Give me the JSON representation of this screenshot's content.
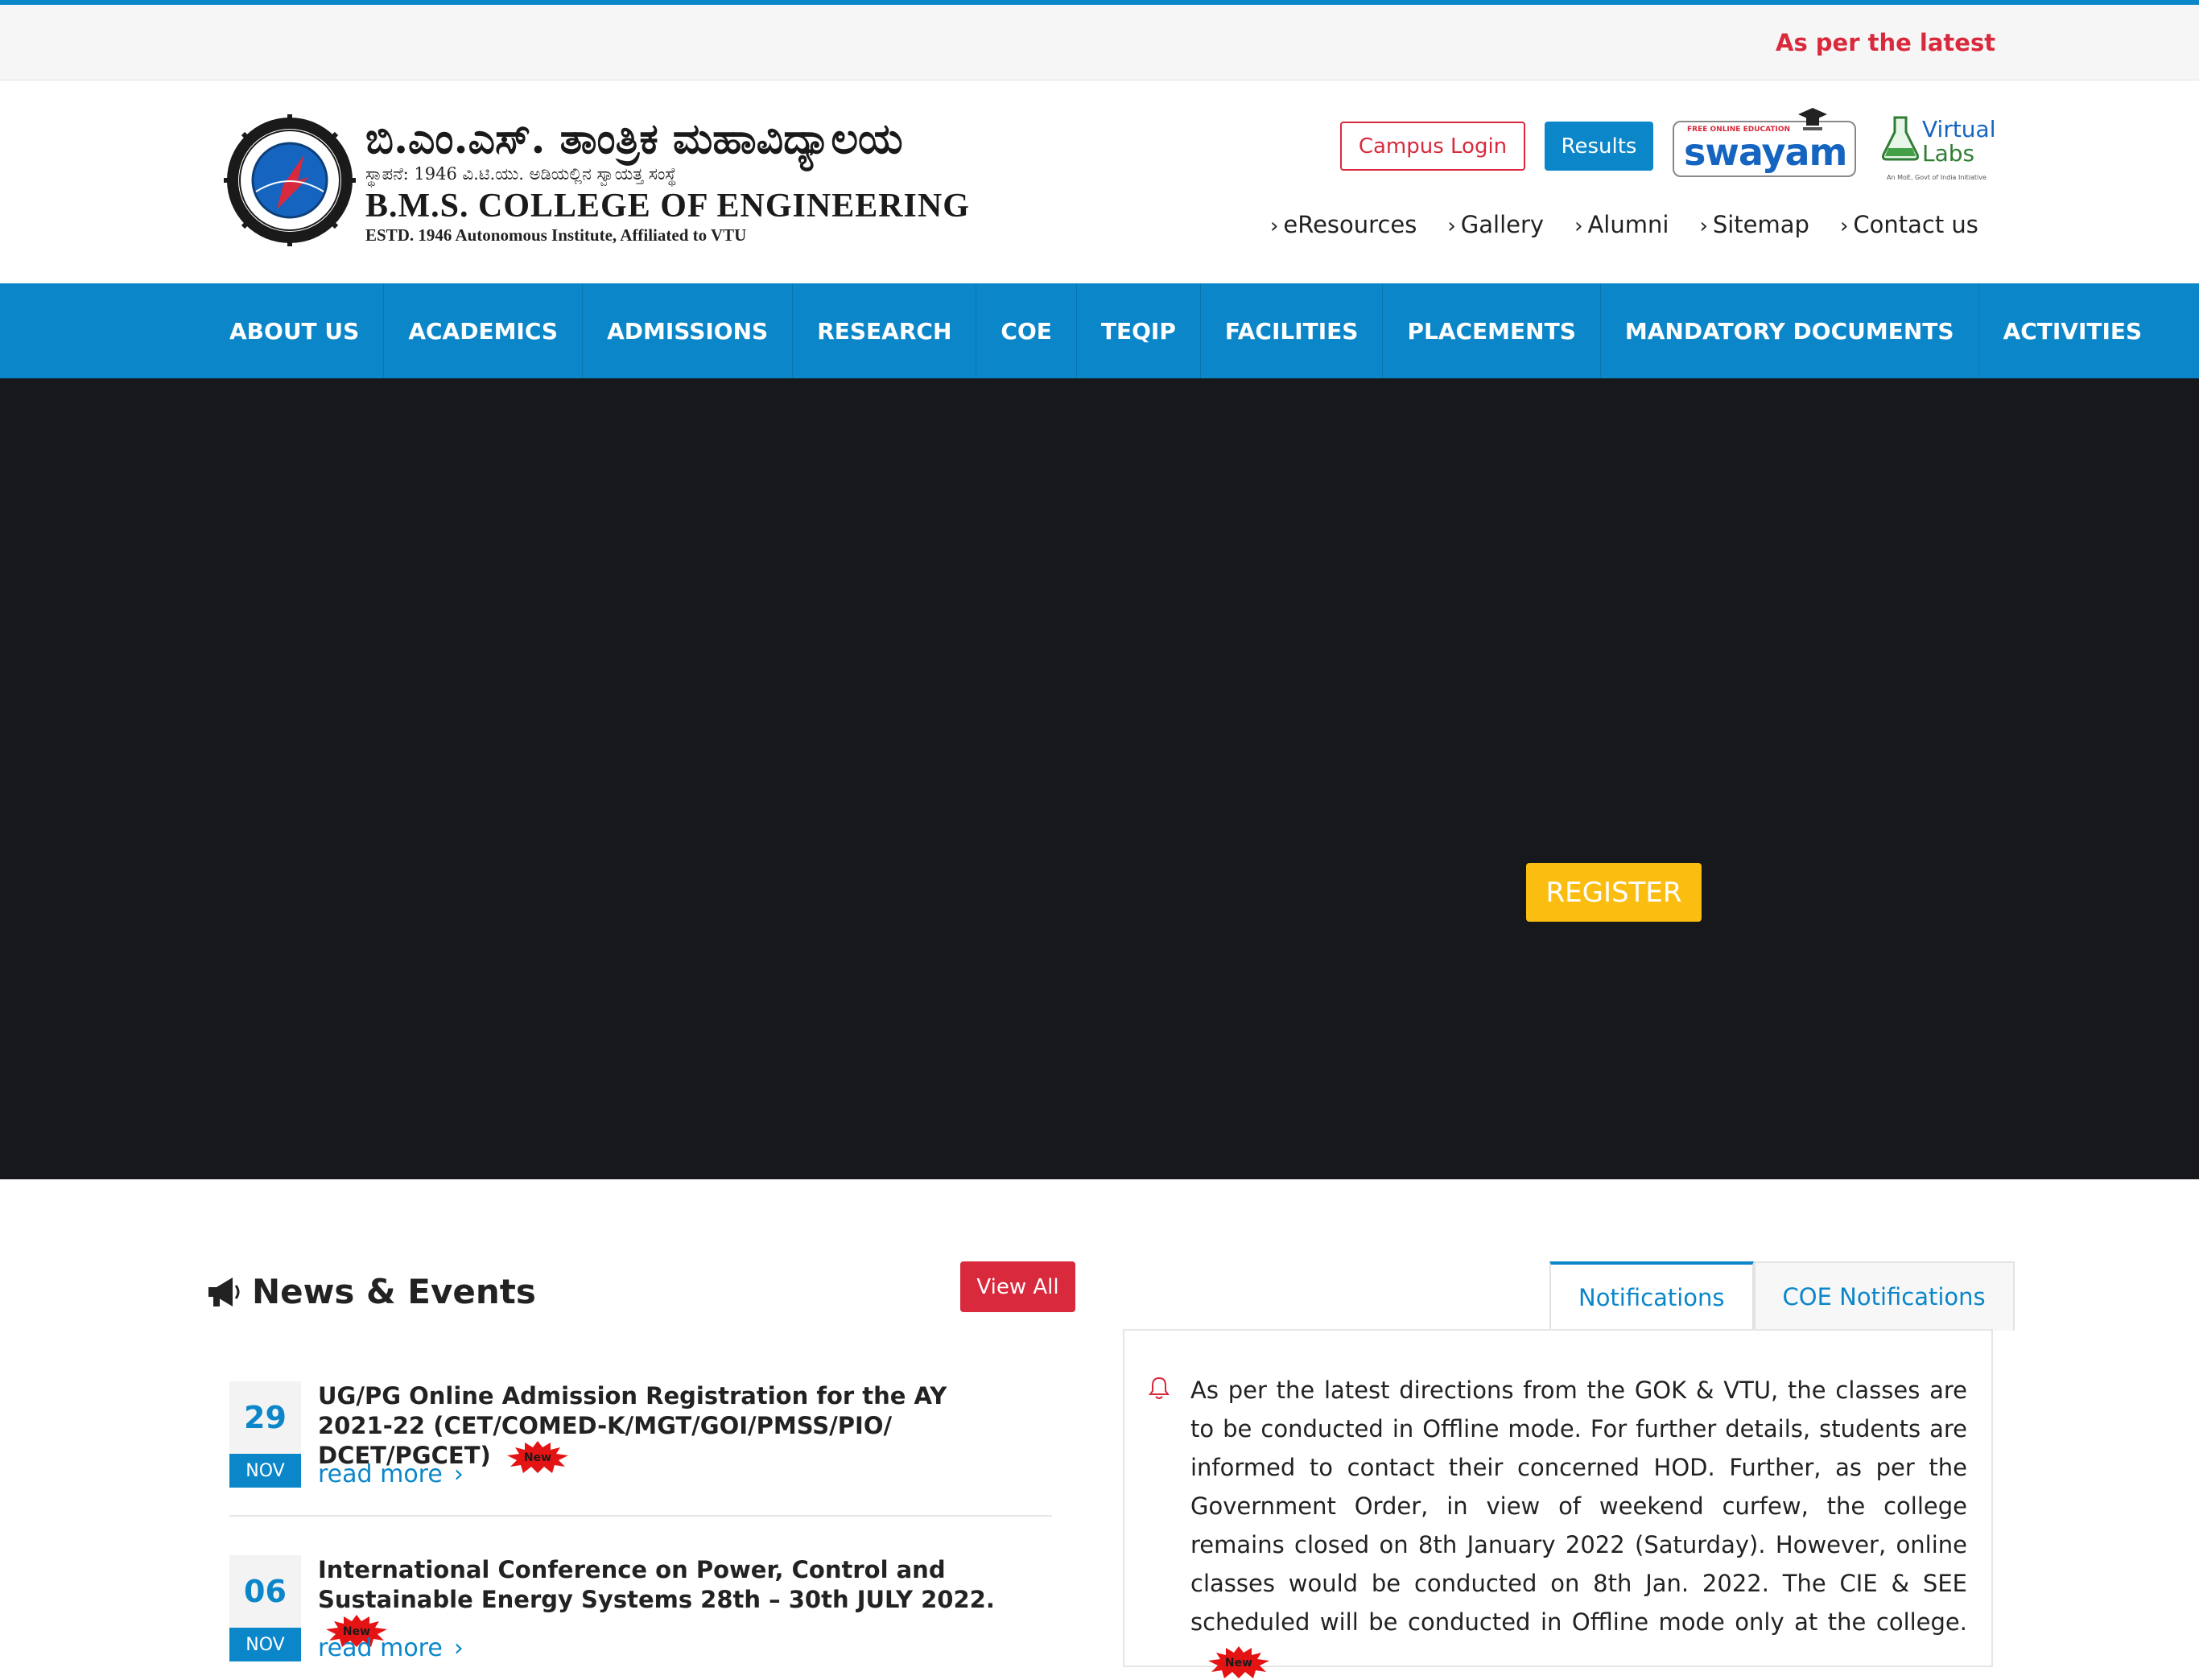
{
  "ticker": {
    "text": "As per the latest"
  },
  "logo": {
    "kannada_title": "ಬಿ.ಎಂ.ಎಸ್. ತಾಂತ್ರಿಕ ಮಹಾವಿದ್ಯಾಲಯ",
    "kannada_sub": "ಸ್ಥಾಪನೆ: 1946  ವಿ.ಟಿ.ಯು. ಅಡಿಯಲ್ಲಿನ ಸ್ವಾಯತ್ತ ಸಂಸ್ಥೆ",
    "english_title": "B.M.S. COLLEGE OF ENGINEERING",
    "english_sub": "ESTD. 1946  Autonomous Institute, Affiliated to VTU"
  },
  "header": {
    "campus_login": "Campus Login",
    "results": "Results",
    "swayam_tag": "FREE ONLINE EDUCATION",
    "swayam": "swayam",
    "vlabs_line1": "Virtual",
    "vlabs_line2": "Labs",
    "vlabs_tag": "An MoE, Govt of India Initiative",
    "quick_links": [
      "eResources",
      "Gallery",
      "Alumni",
      "Sitemap",
      "Contact us"
    ]
  },
  "nav": {
    "items": [
      "ABOUT US",
      "ACADEMICS",
      "ADMISSIONS",
      "RESEARCH",
      "COE",
      "TEQIP",
      "FACILITIES",
      "PLACEMENTS",
      "MANDATORY DOCUMENTS",
      "ACTIVITIES"
    ]
  },
  "hero": {
    "register": "REGISTER"
  },
  "news": {
    "heading": "News & Events",
    "view_all": "View All",
    "items": [
      {
        "day": "29",
        "month": "NOV",
        "title": "UG/PG Online Admission Registration for the AY 2021-22 (CET/COMED-K/MGT/GOI/PMSS/PIO/ DCET/PGCET)",
        "read_more": "read more"
      },
      {
        "day": "06",
        "month": "NOV",
        "title": "International Conference on Power, Control and Sustainable Energy Systems 28th – 30th JULY 2022.",
        "read_more": "read more"
      }
    ],
    "badge": "New"
  },
  "notifications": {
    "tabs": [
      "Notifications",
      "COE Notifications"
    ],
    "active_tab": "Notifications",
    "text": "As per the latest directions from the GOK & VTU, the classes are to be conducted in Offline mode. For further details, students are informed to contact their concerned HOD. Further, as per the Government Order, in view of weekend curfew, the college remains closed on 8th January 2022 (Saturday). However, online classes would be conducted on 8th Jan. 2022. The CIE & SEE scheduled will be conducted in Offline mode only at the college.",
    "badge": "New"
  },
  "colors": {
    "primary": "#0b86c9",
    "accent": "#d9293c",
    "register": "#fcbd11",
    "hero_bg": "#17181b"
  }
}
